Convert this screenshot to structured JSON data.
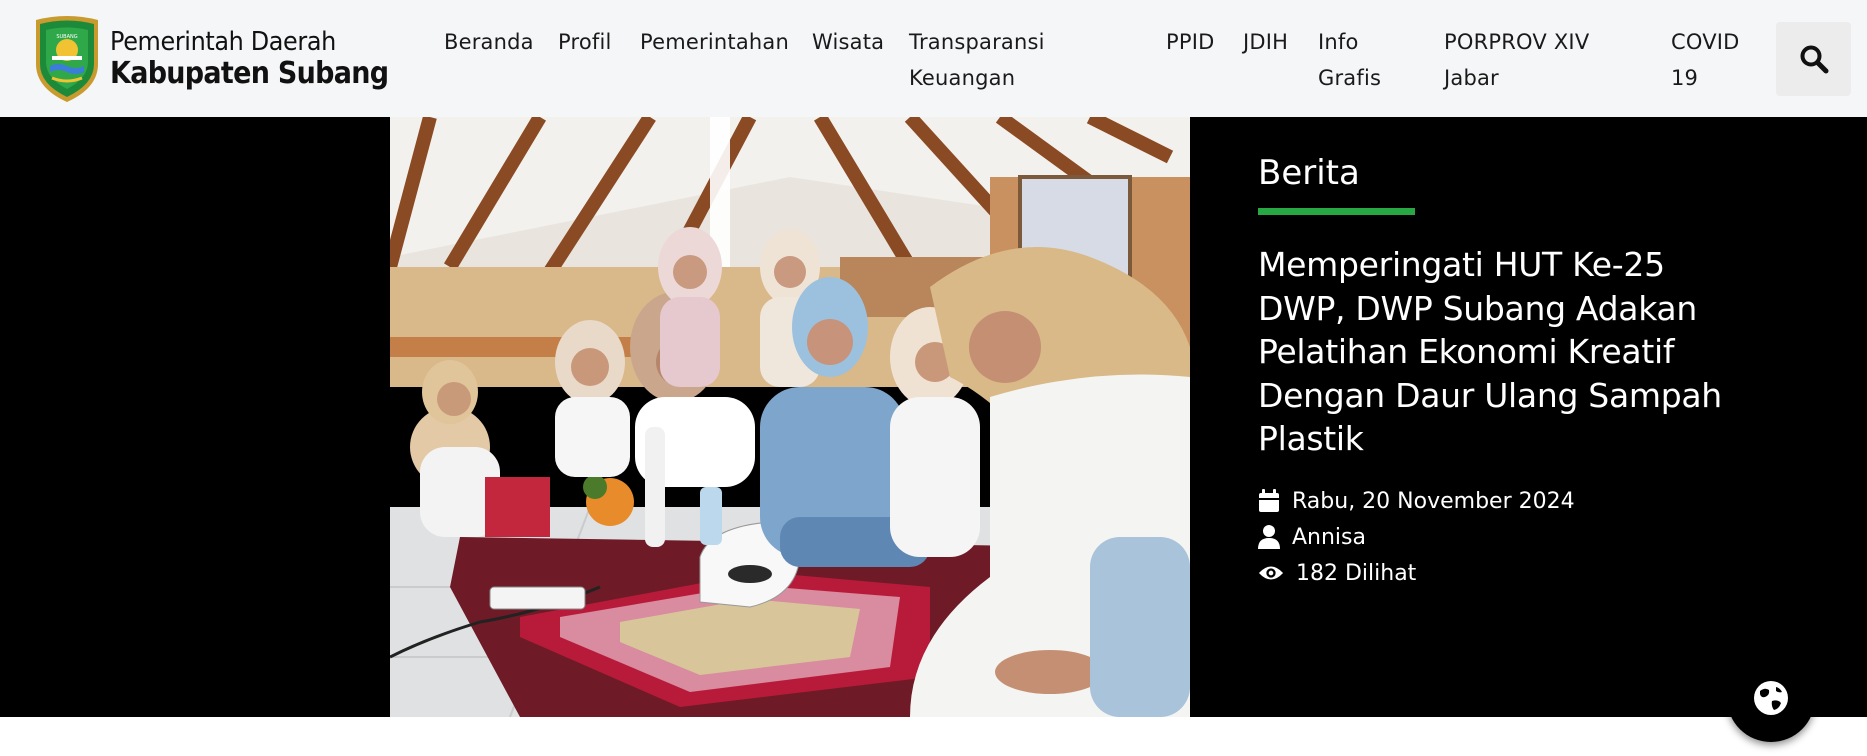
{
  "header": {
    "logo_line1": "Pemerintah Daerah",
    "logo_line2": "Kabupaten Subang",
    "emblem_icon": "kabupaten-subang-emblem",
    "nav": [
      {
        "id": "beranda",
        "label": "Beranda"
      },
      {
        "id": "profil",
        "label": "Profil"
      },
      {
        "id": "pemerintahan",
        "label": "Pemerintahan"
      },
      {
        "id": "wisata",
        "label": "Wisata"
      },
      {
        "id": "transparansi-keuangan",
        "label_line1": "Transparansi",
        "label_line2": "Keuangan"
      },
      {
        "id": "ppid",
        "label": "PPID"
      },
      {
        "id": "jdih",
        "label": "JDIH"
      },
      {
        "id": "info-grafis",
        "label_line1": "Info",
        "label_line2": "Grafis"
      },
      {
        "id": "porprov",
        "label_line1": "PORPROV XIV",
        "label_line2": "Jabar"
      },
      {
        "id": "covid",
        "label_line1": "COVID",
        "label_line2": "19"
      }
    ],
    "search_icon": "search-icon"
  },
  "hero": {
    "photo_alt": "women-ironing-plastic-workshop-photo",
    "category": "Berita",
    "title": "Memperingati HUT Ke-25 DWP, DWP Subang Adakan Pelatihan Ekonomi Kreatif Dengan Daur Ulang Sampah Plastik",
    "date": "Rabu, 20 November 2024",
    "author": "Annisa",
    "views": "182 Dilihat"
  },
  "colors": {
    "header_bg": "#f5f6f8",
    "hero_bg": "#000000",
    "accent_green": "#27a844",
    "text_dark": "#1a1a1a",
    "text_light": "#ffffff"
  },
  "floating_button": {
    "icon": "globe-icon"
  }
}
